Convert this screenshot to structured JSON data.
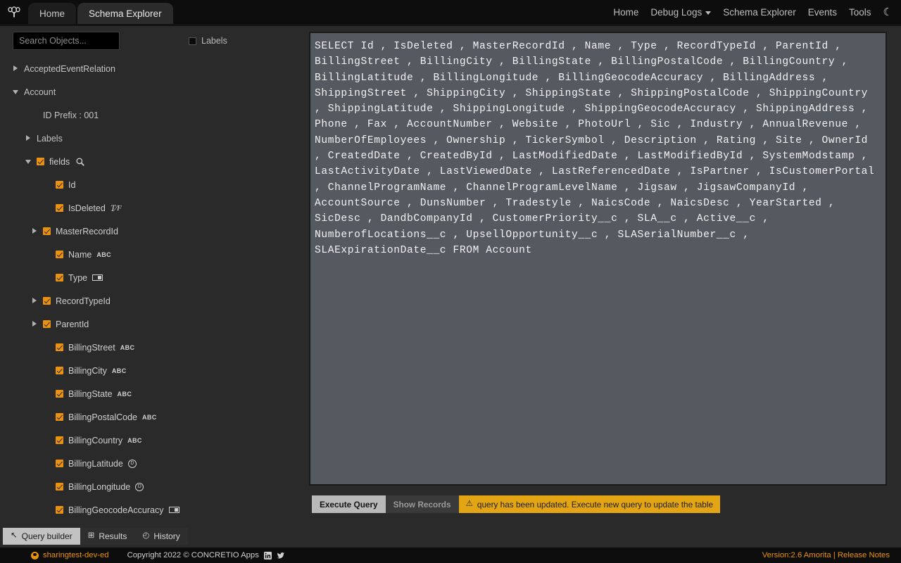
{
  "topnav": {
    "logo_icon": "concretio-tree-logo",
    "tabs": [
      {
        "label": "Home",
        "active": false
      },
      {
        "label": "Schema Explorer",
        "active": true
      }
    ],
    "links": [
      {
        "label": "Home",
        "has_caret": false
      },
      {
        "label": "Debug Logs",
        "has_caret": true
      },
      {
        "label": "Schema Explorer",
        "has_caret": false
      },
      {
        "label": "Events",
        "has_caret": false
      },
      {
        "label": "Tools",
        "has_caret": false
      }
    ],
    "theme_toggle_icon": "moon-icon",
    "theme_toggle_glyph": "☾"
  },
  "sidebar": {
    "search": {
      "placeholder": "Search Objects...",
      "value": ""
    },
    "labels_checkbox": {
      "label": "Labels",
      "checked": false
    },
    "tree": [
      {
        "level": 0,
        "arrow": "right",
        "checkbox": "none",
        "label": "AcceptedEventRelation",
        "type_icon": "none"
      },
      {
        "level": 0,
        "arrow": "down",
        "checkbox": "none",
        "label": "Account",
        "type_icon": "none"
      },
      {
        "level": 2,
        "arrow": "none",
        "checkbox": "none",
        "label": "ID Prefix : 001",
        "type_icon": "none"
      },
      {
        "level": 1,
        "arrow": "right",
        "checkbox": "none",
        "label": "Labels",
        "type_icon": "none"
      },
      {
        "level": 1,
        "arrow": "down",
        "checkbox": "on",
        "label": "fields",
        "type_icon": "magnifier"
      },
      {
        "level": 3,
        "arrow": "none",
        "checkbox": "on",
        "label": "Id",
        "type_icon": "none"
      },
      {
        "level": 3,
        "arrow": "none",
        "checkbox": "on",
        "label": "IsDeleted",
        "type_icon": "boolean"
      },
      {
        "level": 2,
        "arrow": "right",
        "checkbox": "on",
        "label": "MasterRecordId",
        "type_icon": "none"
      },
      {
        "level": 3,
        "arrow": "none",
        "checkbox": "on",
        "label": "Name",
        "type_icon": "abc"
      },
      {
        "level": 3,
        "arrow": "none",
        "checkbox": "on",
        "label": "Type",
        "type_icon": "picklist"
      },
      {
        "level": 2,
        "arrow": "right",
        "checkbox": "on",
        "label": "RecordTypeId",
        "type_icon": "none"
      },
      {
        "level": 2,
        "arrow": "right",
        "checkbox": "on",
        "label": "ParentId",
        "type_icon": "none"
      },
      {
        "level": 3,
        "arrow": "none",
        "checkbox": "on",
        "label": "BillingStreet",
        "type_icon": "abc"
      },
      {
        "level": 3,
        "arrow": "none",
        "checkbox": "on",
        "label": "BillingCity",
        "type_icon": "abc"
      },
      {
        "level": 3,
        "arrow": "none",
        "checkbox": "on",
        "label": "BillingState",
        "type_icon": "abc"
      },
      {
        "level": 3,
        "arrow": "none",
        "checkbox": "on",
        "label": "BillingPostalCode",
        "type_icon": "abc"
      },
      {
        "level": 3,
        "arrow": "none",
        "checkbox": "on",
        "label": "BillingCountry",
        "type_icon": "abc"
      },
      {
        "level": 3,
        "arrow": "none",
        "checkbox": "on",
        "label": "BillingLatitude",
        "type_icon": "double"
      },
      {
        "level": 3,
        "arrow": "none",
        "checkbox": "on",
        "label": "BillingLongitude",
        "type_icon": "double"
      },
      {
        "level": 3,
        "arrow": "none",
        "checkbox": "on",
        "label": "BillingGeocodeAccuracy",
        "type_icon": "picklist"
      }
    ]
  },
  "editor": {
    "query": "SELECT Id , IsDeleted , MasterRecordId , Name , Type , RecordTypeId , ParentId , BillingStreet , BillingCity , BillingState , BillingPostalCode , BillingCountry , BillingLatitude , BillingLongitude , BillingGeocodeAccuracy , BillingAddress , ShippingStreet , ShippingCity , ShippingState , ShippingPostalCode , ShippingCountry , ShippingLatitude , ShippingLongitude , ShippingGeocodeAccuracy , ShippingAddress , Phone , Fax , AccountNumber , Website , PhotoUrl , Sic , Industry , AnnualRevenue , NumberOfEmployees , Ownership , TickerSymbol , Description , Rating , Site , OwnerId , CreatedDate , CreatedById , LastModifiedDate , LastModifiedById , SystemModstamp , LastActivityDate , LastViewedDate , LastReferencedDate , IsPartner , IsCustomerPortal , ChannelProgramName , ChannelProgramLevelName , Jigsaw , JigsawCompanyId , AccountSource , DunsNumber , Tradestyle , NaicsCode , NaicsDesc , YearStarted , SicDesc , DandbCompanyId , CustomerPriority__c , SLA__c , Active__c , NumberofLocations__c , UpsellOpportunity__c , SLASerialNumber__c , SLAExpirationDate__c FROM Account"
  },
  "actionbar": {
    "execute_label": "Execute Query",
    "show_records_label": "Show Records",
    "warning_icon": "warning-triangle-icon",
    "warning_glyph": "⚠",
    "warning_text": "query has been updated. Execute new query to update the table"
  },
  "bottom_tabs": [
    {
      "label": "Query builder",
      "icon": "arrow-cursor-icon",
      "glyph": "↖",
      "active": true
    },
    {
      "label": "Results",
      "icon": "grid-icon",
      "glyph": "⊞",
      "active": false
    },
    {
      "label": "History",
      "icon": "clock-icon",
      "glyph": "◴",
      "active": false
    }
  ],
  "footer": {
    "user_icon": "user-avatar-icon",
    "username": "sharingtest-dev-ed",
    "copyright": "Copyright 2022 © CONCRETIO Apps",
    "social": [
      {
        "name": "linkedin-icon",
        "glyph": "in"
      },
      {
        "name": "twitter-icon",
        "glyph": "🐦"
      }
    ],
    "version_text": "Version:2.6 Amorita | Release Notes"
  },
  "colors": {
    "accent_orange": "#e8920a",
    "warning_yellow": "#e3a514",
    "editor_bg": "#555a61",
    "sidebar_bg": "#2a2a2a",
    "nav_bg": "#0d0d0d"
  }
}
